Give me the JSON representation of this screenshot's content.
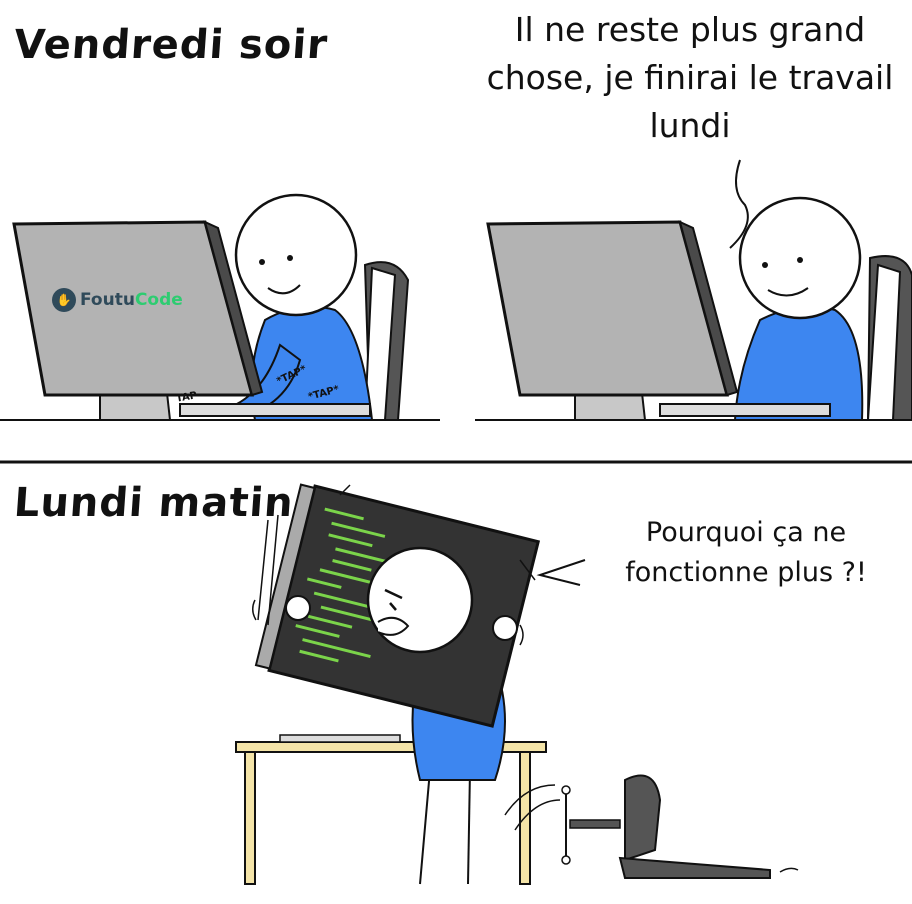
{
  "panels": {
    "top": {
      "caption": "Vendredi soir",
      "speech": "Il ne reste plus grand chose, je finirai le travail lundi",
      "logo": {
        "part1": "Foutu",
        "part2": "Code",
        "icon": "hand-icon"
      },
      "sfx": [
        "TAP",
        "*TAP*",
        "*TAP*"
      ]
    },
    "bottom": {
      "caption": "Lundi matin",
      "speech": "Pourquoi ça ne fonctionne plus ?!"
    }
  },
  "colors": {
    "shirt": "#3d86f0",
    "screen": "#b3b3b3",
    "monitor_side": "#4a4a4a",
    "chair": "#555555",
    "desk": "#f4e4a8",
    "code_green": "#7bd44a",
    "logo_green": "#2ecc71",
    "logo_dark": "#2f4a5a"
  }
}
